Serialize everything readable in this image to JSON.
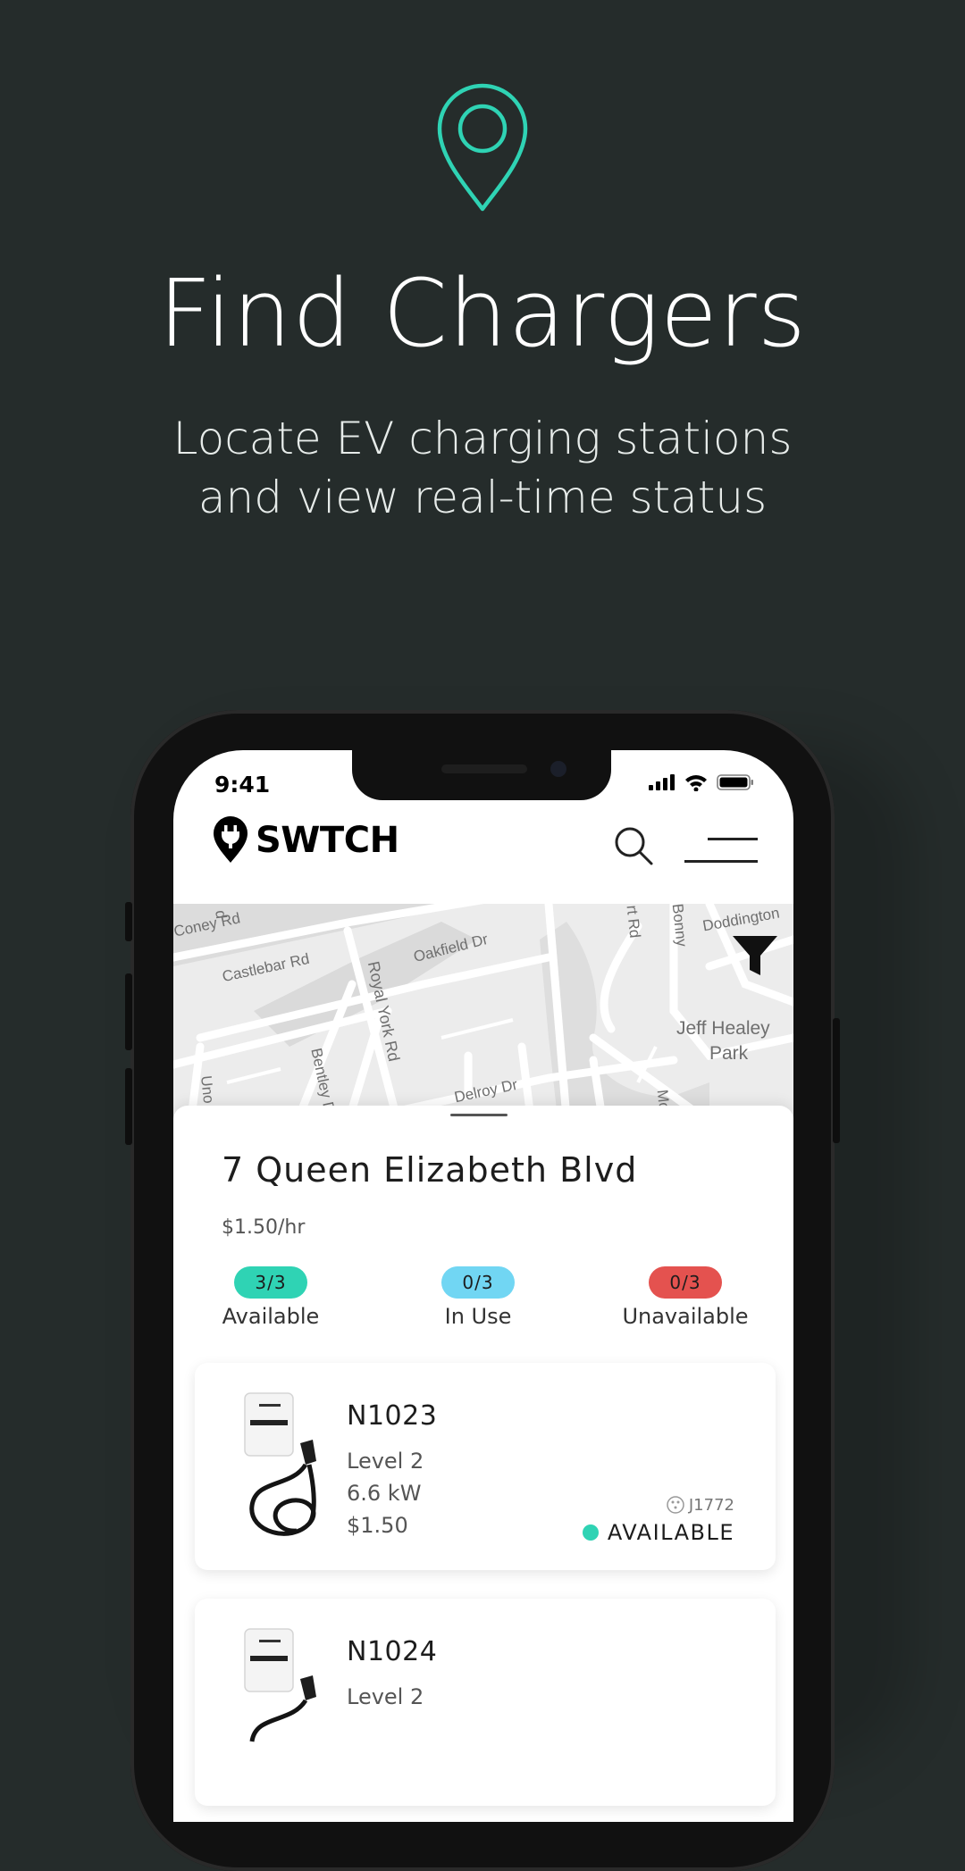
{
  "hero": {
    "title": "Find Chargers",
    "subtitle_line1": "Locate EV charging stations",
    "subtitle_line2": "and view real-time status",
    "icon": "location-pin-icon",
    "accent_color": "#2fd3b4"
  },
  "status_bar": {
    "time": "9:41"
  },
  "app": {
    "brand": "SWTCH",
    "logo_icon": "plug-pin-icon",
    "search_icon": "search-icon",
    "menu_icon": "menu-icon"
  },
  "map": {
    "labels": [
      "Coney Rd",
      "Castlebar Rd",
      "Oakfield Dr",
      "Royal York Rd",
      "Bentley D",
      "Delroy Dr",
      "Doddington",
      "Jeff Healey",
      "Park",
      "rt Rd",
      "Bonny",
      "Uno",
      "Mo",
      "d"
    ],
    "filter_icon": "filter-icon"
  },
  "location": {
    "address": "7 Queen Elizabeth Blvd",
    "price": "$1.50/hr",
    "stats": [
      {
        "count": "3/3",
        "label": "Available",
        "color": "#2fd3b4"
      },
      {
        "count": "0/3",
        "label": "In Use",
        "color": "#71d6f3"
      },
      {
        "count": "0/3",
        "label": "Unavailable",
        "color": "#e4524f"
      }
    ]
  },
  "chargers": [
    {
      "id": "N1023",
      "level": "Level 2",
      "power": "6.6 kW",
      "price": "$1.50",
      "connector": "J1772",
      "status": "AVAILABLE"
    },
    {
      "id": "N1024",
      "level": "Level 2"
    }
  ]
}
